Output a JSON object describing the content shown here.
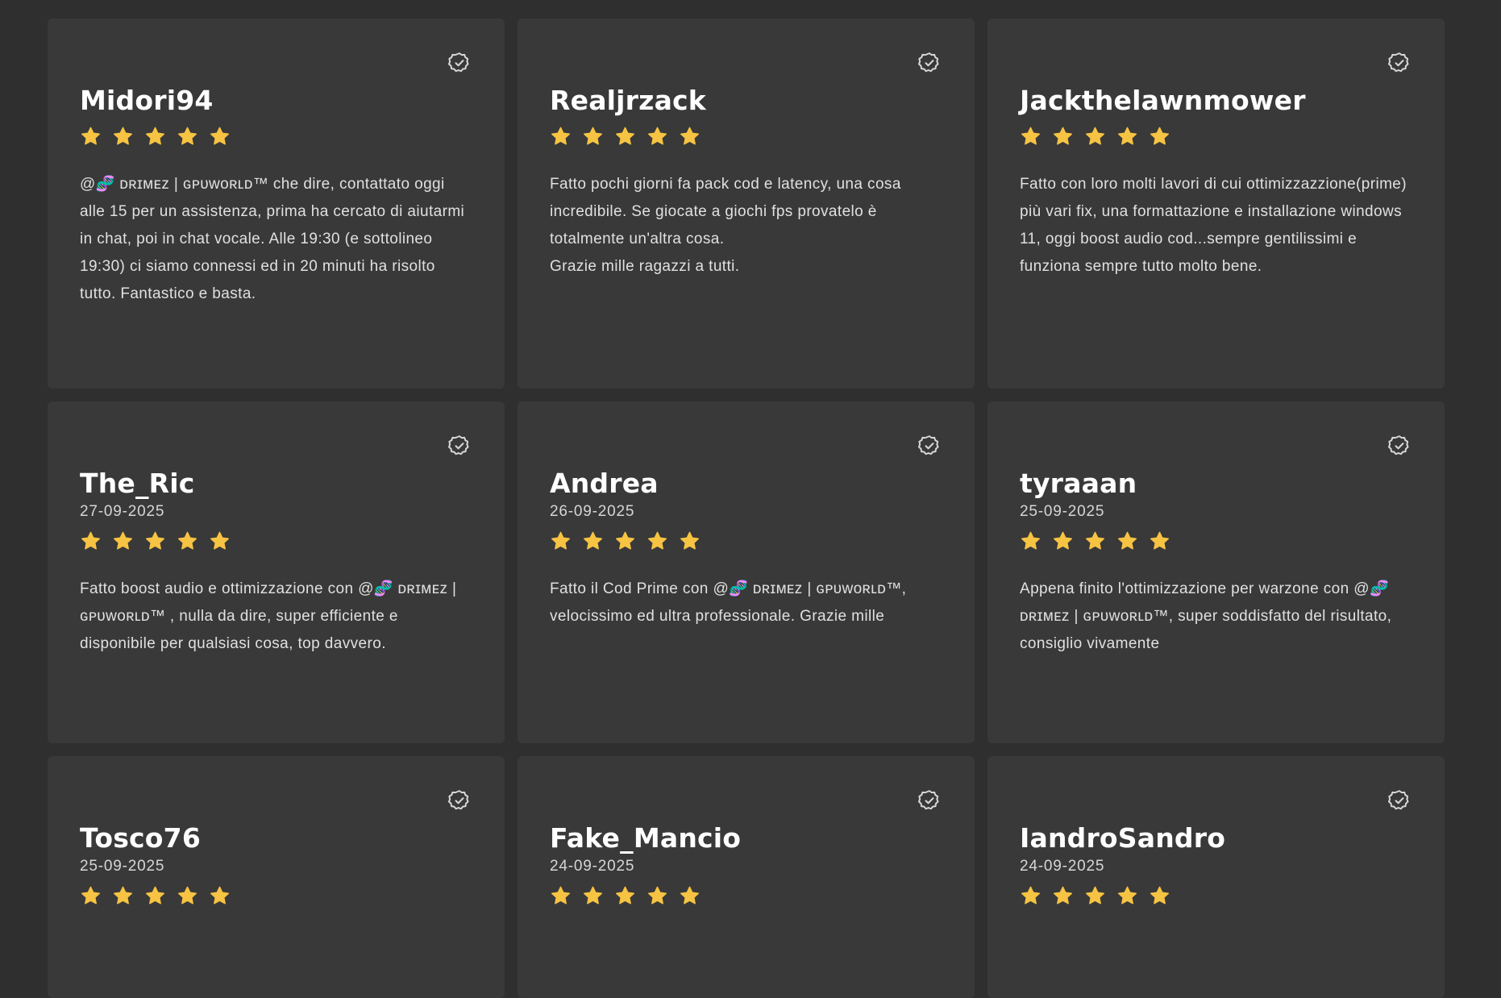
{
  "colors": {
    "page_background": "#2f2f2f",
    "card_background": "#393939",
    "star": "#f6c343",
    "name": "#ffffff",
    "text": "#e0e0e0"
  },
  "icons": {
    "verified": "verified-badge-icon",
    "star": "star-icon"
  },
  "reviews": [
    {
      "name": "Midori94",
      "date": "",
      "rating": 5,
      "text": "@🧬 ᴅʀɪᴍᴇᴢ | ɢᴘᴜᴡᴏʀʟᴅ™ che dire, contattato oggi alle 15 per un assistenza, prima ha cercato di aiutarmi in chat, poi in chat vocale. Alle 19:30 (e sottolineo 19:30) ci siamo connessi ed in 20 minuti ha risolto tutto. Fantastico e basta."
    },
    {
      "name": "Realjrzack",
      "date": "",
      "rating": 5,
      "text": "Fatto pochi giorni fa pack cod e latency, una cosa incredibile. Se giocate a giochi fps provatelo è totalmente un'altra cosa.\nGrazie mille ragazzi a tutti."
    },
    {
      "name": "Jackthelawnmower",
      "date": "",
      "rating": 5,
      "text": "Fatto con loro molti lavori di cui ottimizzazzione(prime) più vari fix, una formattazione e installazione windows 11, oggi boost audio cod...sempre gentilissimi e funziona sempre tutto molto bene."
    },
    {
      "name": "The_Ric",
      "date": "27-09-2025",
      "rating": 5,
      "text": "Fatto boost audio e ottimizzazione con @🧬 ᴅʀɪᴍᴇᴢ | ɢᴘᴜᴡᴏʀʟᴅ™ , nulla da dire, super efficiente e disponibile per qualsiasi cosa, top davvero."
    },
    {
      "name": "Andrea",
      "date": "26-09-2025",
      "rating": 5,
      "text": "Fatto il Cod Prime con @🧬 ᴅʀɪᴍᴇᴢ | ɢᴘᴜᴡᴏʀʟᴅ™, velocissimo ed ultra professionale. Grazie mille"
    },
    {
      "name": "tyraaan",
      "date": "25-09-2025",
      "rating": 5,
      "text": "Appena finito l'ottimizzazione per warzone con @🧬 ᴅʀɪᴍᴇᴢ | ɢᴘᴜᴡᴏʀʟᴅ™, super soddisfatto del risultato, consiglio vivamente"
    },
    {
      "name": "Tosco76",
      "date": "25-09-2025",
      "rating": 5,
      "text": ""
    },
    {
      "name": "Fake_Mancio",
      "date": "24-09-2025",
      "rating": 5,
      "text": ""
    },
    {
      "name": "IandroSandro",
      "date": "24-09-2025",
      "rating": 5,
      "text": ""
    }
  ]
}
